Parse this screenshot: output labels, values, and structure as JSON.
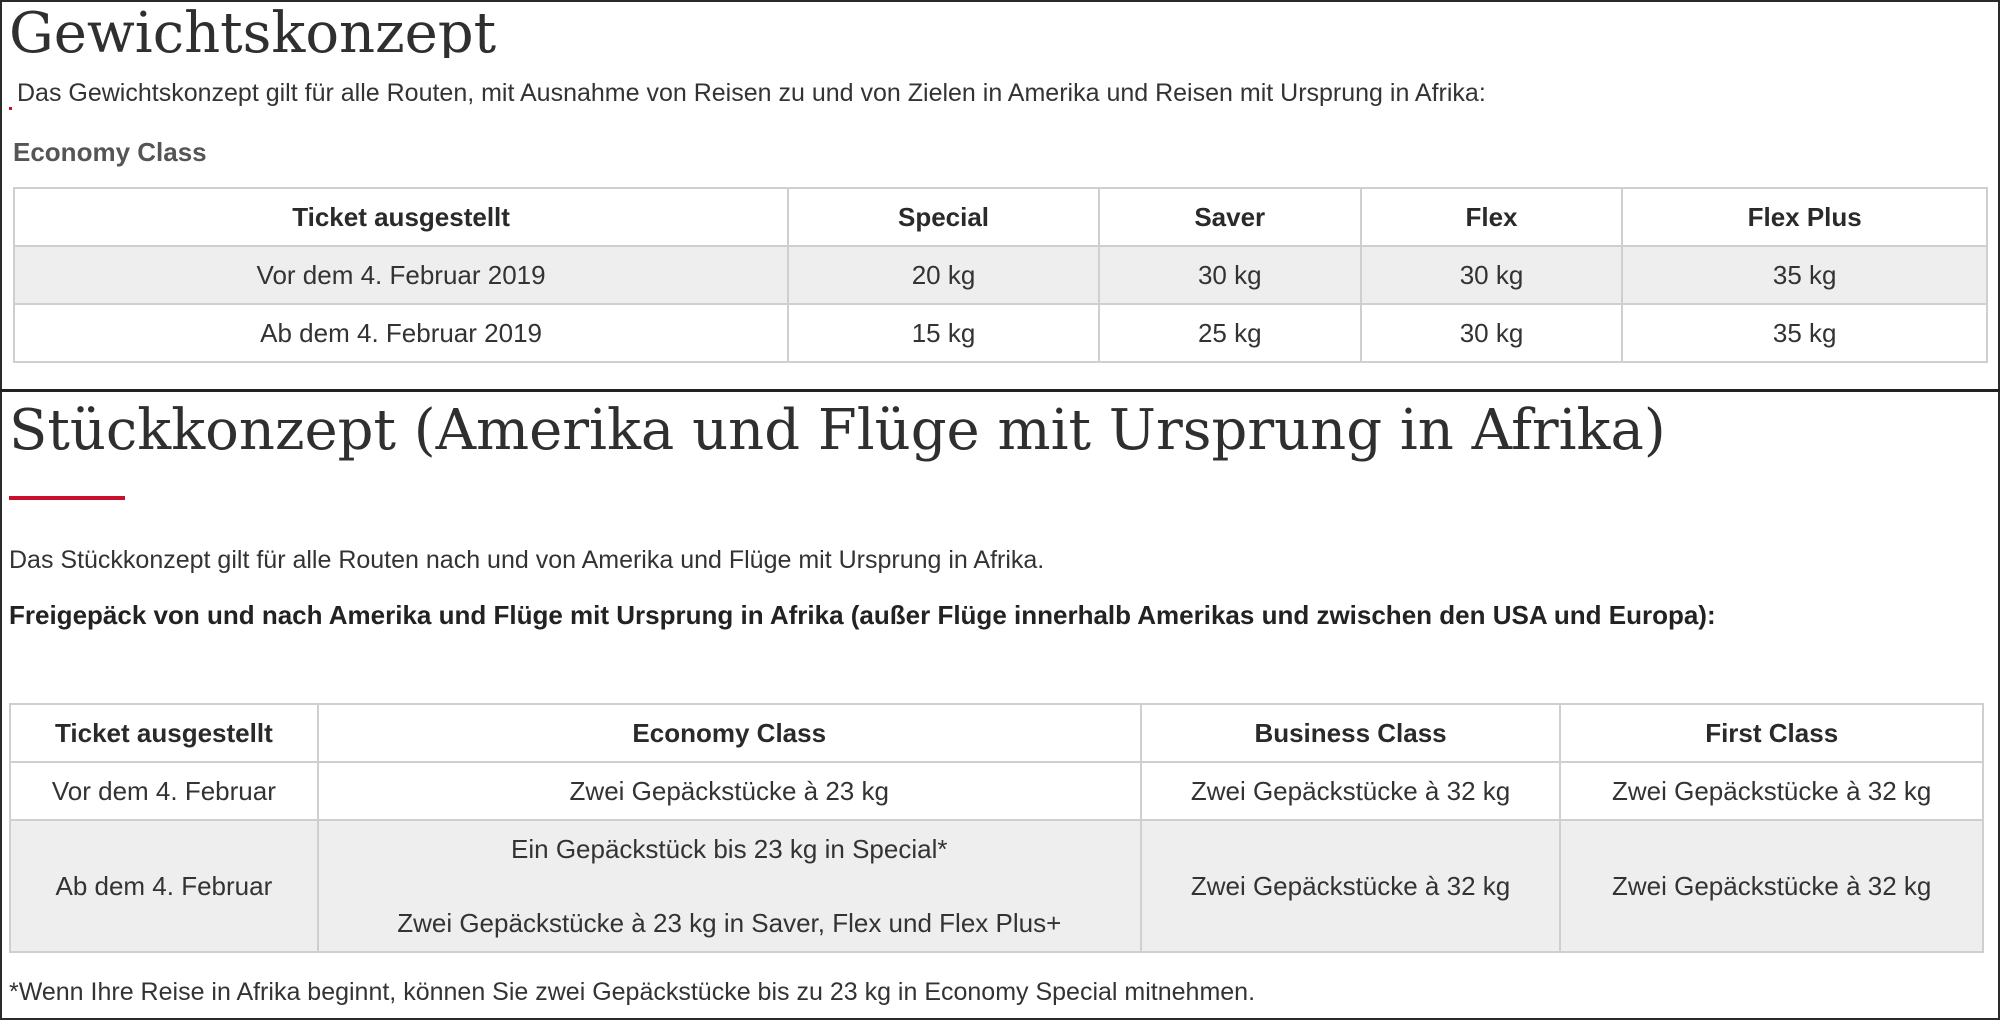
{
  "section1": {
    "title": "Gewichtskonzept",
    "intro": "Das Gewichtskonzept gilt für alle Routen, mit Ausnahme von Reisen zu und von Zielen in Amerika und Reisen mit Ursprung in Afrika:",
    "subheading": "Economy Class",
    "table": {
      "headers": [
        "Ticket ausgestellt",
        "Special",
        "Saver",
        "Flex",
        "Flex Plus"
      ],
      "rows": [
        [
          "Vor dem 4. Februar 2019",
          "20 kg",
          "30 kg",
          "30 kg",
          "35 kg"
        ],
        [
          "Ab dem 4. Februar 2019",
          "15 kg",
          "25 kg",
          "30 kg",
          "35 kg"
        ]
      ]
    }
  },
  "section2": {
    "title": "Stückkonzept (Amerika und Flüge mit Ursprung in Afrika)",
    "intro": "Das Stückkonzept gilt für alle Routen nach und von Amerika und Flüge mit Ursprung in Afrika.",
    "bold_line": "Freigepäck von und nach Amerika und Flüge mit Ursprung in Afrika (außer Flüge innerhalb Amerikas und zwischen den USA und Europa):",
    "table": {
      "headers": [
        "Ticket ausgestellt",
        "Economy Class",
        "Business Class",
        "First Class"
      ],
      "row1": [
        "Vor dem 4. Februar",
        "Zwei Gepäckstücke à 23 kg",
        "Zwei Gepäckstücke à 32 kg",
        "Zwei Gepäckstücke à 32 kg"
      ],
      "row2": {
        "ticket": "Ab dem 4. Februar",
        "economy_line1": "Ein Gepäckstück bis 23 kg in Special*",
        "economy_line2": "Zwei Gepäckstücke à 23 kg in Saver, Flex und Flex Plus+",
        "business": "Zwei Gepäckstücke à 32 kg",
        "first": "Zwei Gepäckstücke à 32 kg"
      }
    },
    "footnote": "*Wenn Ihre Reise in Afrika beginnt, können Sie zwei Gepäckstücke bis zu 23 kg in Economy Special mitnehmen."
  },
  "colors": {
    "accent": "#c8102e",
    "text": "#333333",
    "row_shade": "#eeeeee",
    "border": "#cfcfcf"
  }
}
